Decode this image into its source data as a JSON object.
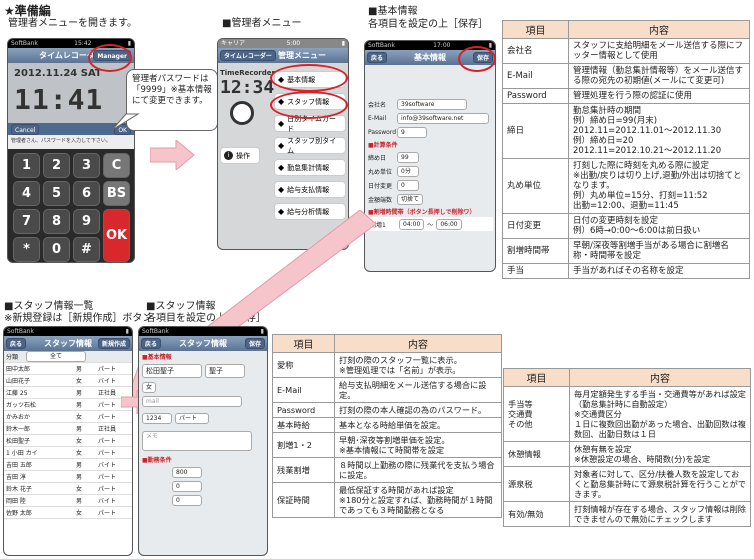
{
  "page_title": "★準備編",
  "captions": {
    "cap1": "管理者メニューを開きます。",
    "cap2": "■管理者メニュー",
    "cap3a": "■基本情報",
    "cap3b": "各項目を設定の上［保存］",
    "cap4a": "■スタッフ情報一覧",
    "cap4b": "※新規登録は［新規作成］ボタン",
    "cap5a": "■スタッフ情報",
    "cap5b": "各項目を設定の上［保存］"
  },
  "callout": "管理者パスワードは「9999」※基本情報にて変更できます。",
  "phone1": {
    "carrier": "SoftBank",
    "time": "15:42",
    "nav": "タイムレコーダー",
    "manager_btn": "Manager",
    "date": "2012.11.24",
    "dow": "SAT",
    "clock": "11:41",
    "bar_left": "Cancel",
    "bar_right": "OK",
    "prompt": "管理者さん、パスワードを入力して下さい。",
    "keys": [
      "1",
      "2",
      "3",
      "C",
      "4",
      "5",
      "6",
      "BS",
      "7",
      "8",
      "9",
      "OK",
      "*",
      "0",
      "#"
    ]
  },
  "phone2": {
    "carrier": "キャリア",
    "time": "5:00",
    "nav": "管理メニュー",
    "back": "タイムレコーダー",
    "logo": "TimeRecorder",
    "logo_clock": "12:34",
    "items": [
      "基本情報",
      "スタッフ情報",
      "日別タイムカード",
      "スタッフ別タイム",
      "勤怠集計情報",
      "給与支払情報",
      "給与分析情報"
    ],
    "side_label": "操作"
  },
  "phone3": {
    "carrier": "SoftBank",
    "time": "17:00",
    "nav": "基本情報",
    "back": "戻る",
    "save": "保存",
    "company_label": "会社名",
    "company": "39software",
    "mail_label": "E-Mail",
    "mail": "info@39software.net",
    "pw_label": "Password",
    "pw": "9",
    "sec_calc": "■計算条件",
    "f_close": "締め日",
    "v_close": "99",
    "f_round": "丸め単位",
    "v_round": "0分",
    "f_daychg": "日付変更",
    "v_daychg": "0",
    "f_extra": "金額端数",
    "v_extra": "切捨て",
    "sec_ext": "■割増時間帯（ボタン長押しで削除ワ）",
    "ext_label": "割増1",
    "ext_from": "04:00",
    "ext_to": "06:00"
  },
  "phone4": {
    "carrier": "SoftBank",
    "nav": "スタッフ情報",
    "back": "戻る",
    "new": "新規作成",
    "filter_label": "分類",
    "filter": "全て",
    "rows": [
      [
        "田中太郎",
        "男",
        "パート"
      ],
      [
        "山田花子",
        "女",
        "バイト"
      ],
      [
        "江藤 25",
        "男",
        "正社員"
      ],
      [
        "ガッツ石松",
        "男",
        "パート"
      ],
      [
        "かみおか",
        "女",
        "パート"
      ],
      [
        "鈴木一郎",
        "男",
        "正社員"
      ],
      [
        "松田聖子",
        "女",
        "パート"
      ],
      [
        "1 小田 カイ",
        "女",
        "パート"
      ],
      [
        "吉田 五郎",
        "男",
        "バイト"
      ],
      [
        "吉田 淳",
        "男",
        "パート"
      ],
      [
        "鈴木 花子",
        "女",
        "パート"
      ],
      [
        "岡田 陸",
        "男",
        "バイト"
      ],
      [
        "佐野 太郎",
        "女",
        "パート"
      ]
    ]
  },
  "phone5": {
    "carrier": "SoftBank",
    "nav": "スタッフ情報",
    "back": "戻る",
    "save": "保存",
    "sec_basic": "■基本情報",
    "name": "松田聖子",
    "kana": "聖子",
    "mail_ph": "mail",
    "pw": "1234",
    "type": "パート",
    "memo_ph": "メモ",
    "sec_pay": "■勤務条件",
    "v1": "800",
    "v2": "0",
    "v3": "0",
    "sex": "女"
  },
  "table1": {
    "head": [
      "項目",
      "内容"
    ],
    "rows": [
      [
        "会社名",
        "スタッフに支給明細をメール送信する際にフッター情報として使用"
      ],
      [
        "E-Mail",
        "管理情報（勤怠集計情報等）をメール送信する際の宛先の初期値(メールにて変更可)"
      ],
      [
        "Password",
        "管理処理を行う際の認証に使用"
      ],
      [
        "締日",
        "勤怠集計時の期間\n例）締め日=99(月末)\n2012.11=2012.11.01～2012.11.30\n例）締め日=20\n2012.11=2012.10.21～2012.11.20"
      ],
      [
        "丸め単位",
        "打刻した際に時刻を丸める際に設定\n※出勤/戻りは切り上げ,退勤/外出は切捨てとなります。\n例）丸め単位=15分、打刻=11:52\n出勤=12:00、退勤=11:45"
      ],
      [
        "日付変更",
        "日付の変更時刻を設定\n例）6時→0:00～6:00は前日扱い"
      ],
      [
        "割増時間帯",
        "早朝/深夜等割増手当がある場合に割増名称・時間帯を設定"
      ],
      [
        "手当",
        "手当があればその名称を設定"
      ]
    ]
  },
  "table2": {
    "head": [
      "項目",
      "内容"
    ],
    "rows": [
      [
        "愛称",
        "打刻の際のスタッフ一覧に表示。\n※管理処理では「名前」が表示。"
      ],
      [
        "E-Mail",
        "給与支払明細をメール送信する場合に設定。"
      ],
      [
        "Password",
        "打刻の際の本人確認の為のパスワード。"
      ],
      [
        "基本時給",
        "基本となる時給単価を設定。"
      ],
      [
        "割増1・2",
        "早朝･深夜等割増単価を設定。\n※基本情報にて時間帯を設定"
      ],
      [
        "残業割増",
        "８時間以上勤務の際に残業代を支払う場合に設定。"
      ],
      [
        "保証時間",
        "最低保証する時間があれば設定\n※180分と設定すれば、勤務時間が１時間であっても３時間勤務となる"
      ]
    ]
  },
  "table3": {
    "head": [
      "項目",
      "内容"
    ],
    "rows": [
      [
        "手当等\n交通費\nその他",
        "毎月定額発生する手当・交通費等があれば設定（勤怠集計時に自動設定）\n※交通費区分\n１日に複数回出勤があった場合、出勤回数は複数回、出勤日数は１日"
      ],
      [
        "休憩情報",
        "休憩有無を設定\n※休憩設定の場合、時間数(分)を設定"
      ],
      [
        "源泉税",
        "対象者に対して、区分/扶養人数を設定しておくと勤怠集計時にて源泉税計算を行うことができます。"
      ],
      [
        "有効/無効",
        "打刻情報が存在する場合、スタッフ情報は削除できませんので無効にチェックします"
      ]
    ]
  }
}
